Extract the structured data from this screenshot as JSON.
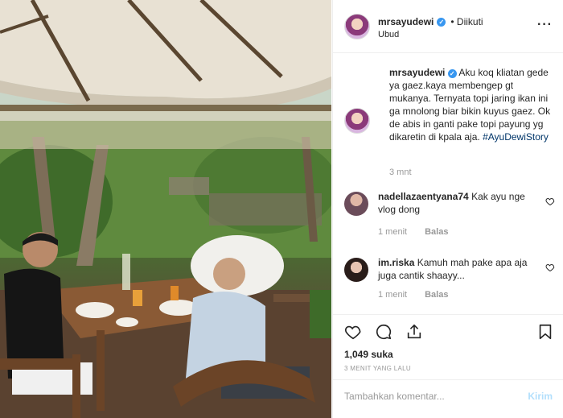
{
  "post": {
    "username": "mrsayudewi",
    "follow_status": "• Diikuti",
    "location": "Ubud",
    "more_icon": "more-options-icon"
  },
  "caption": {
    "username": "mrsayudewi",
    "text": "Aku koq kliatan gede ya gaez.kaya membengep gt mukanya. Ternyata topi jaring ikan ini ga mnolong biar bikin kuyus gaez. Ok de abis in ganti pake topi payung yg dikaretin di kpala aja.",
    "hashtag": "#AyuDewiStory",
    "time": "3 mnt"
  },
  "comments": [
    {
      "username": "nadellazaentyana74",
      "text": "Kak ayu nge vlog dong",
      "time": "1 menit",
      "reply": "Balas"
    },
    {
      "username": "im.riska",
      "text": "Kamuh mah pake apa aja juga cantik shaayy...",
      "time": "1 menit",
      "reply": "Balas"
    }
  ],
  "actions": {
    "likes": "1,049 suka",
    "posted": "3 MENIT YANG LALU"
  },
  "add_comment": {
    "placeholder": "Tambahkan komentar...",
    "send": "Kirim"
  },
  "colors": {
    "link": "#003569",
    "verified": "#3897f0",
    "muted": "#999999",
    "send_disabled": "#b2dffc"
  }
}
